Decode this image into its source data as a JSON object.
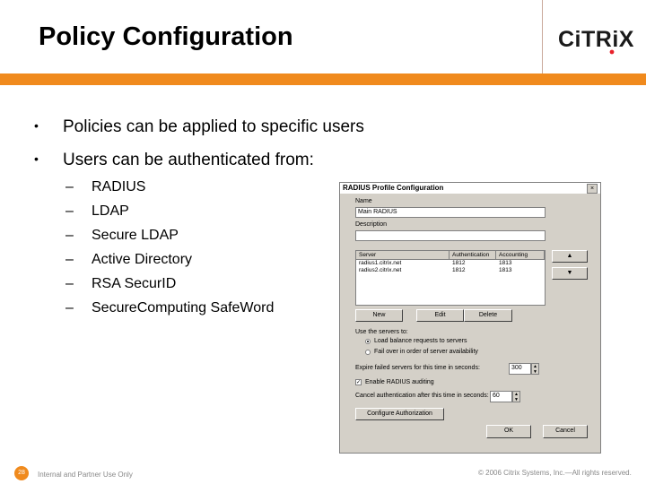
{
  "slide": {
    "title": "Policy Configuration",
    "bullets": [
      "Policies can be applied to specific users",
      "Users can be authenticated from:"
    ],
    "sub_bullets": [
      "RADIUS",
      "LDAP",
      "Secure LDAP",
      "Active Directory",
      "RSA SecurID",
      "SecureComputing SafeWord"
    ],
    "bullet_symbol": "•",
    "dash_symbol": "–"
  },
  "logo": {
    "text": "CiTRiX",
    "accent_color": "#e8202a"
  },
  "dialog": {
    "title": "RADIUS Profile Configuration",
    "close_glyph": "×",
    "name_label": "Name",
    "name_value": "Main RADIUS",
    "description_label": "Description",
    "description_value": "",
    "columns": [
      "Server",
      "Authentication",
      "Accounting"
    ],
    "rows": [
      [
        "radius1.citrix.net",
        "1812",
        "1813"
      ],
      [
        "radius2.citrix.net",
        "1812",
        "1813"
      ]
    ],
    "up_glyph": "▲",
    "down_glyph": "▼",
    "new_button": "New",
    "edit_button": "Edit",
    "delete_button": "Delete",
    "use_servers_label": "Use the servers to:",
    "radio_balance": "Load balance requests to servers",
    "radio_failover": "Fail over in order of server availability",
    "expire_label": "Expire failed servers for this time in seconds:",
    "expire_value": "300",
    "enable_auditing_label": "Enable RADIUS auditing",
    "cancel_auth_label": "Cancel authentication after this time in seconds:",
    "cancel_auth_value": "60",
    "configure_auth_button": "Configure Authorization",
    "ok_button": "OK",
    "cancel_button": "Cancel"
  },
  "footer": {
    "page_number": "28",
    "left_text": "Internal and Partner Use Only",
    "right_text": "© 2006 Citrix Systems, Inc.—All rights reserved."
  },
  "colors": {
    "accent": "#f08a1d"
  }
}
